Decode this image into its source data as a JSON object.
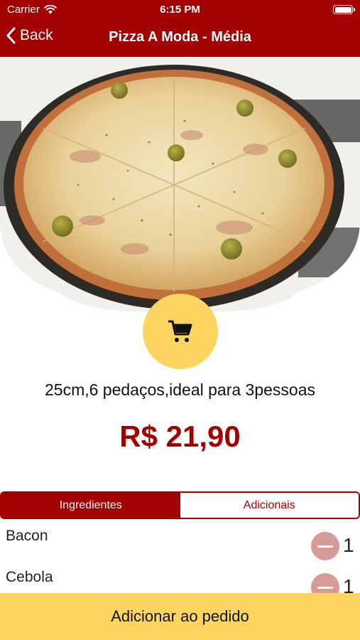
{
  "status_bar": {
    "carrier": "Carrier",
    "time": "6:15 PM"
  },
  "nav": {
    "back_label": "Back",
    "title": "Pizza A Moda - Média"
  },
  "product": {
    "description": "25cm,6 pedaços,ideal para 3pessoas",
    "price": "R$ 21,90"
  },
  "tabs": [
    {
      "label": "Ingredientes",
      "active": true
    },
    {
      "label": "Adicionais",
      "active": false
    }
  ],
  "ingredients": [
    {
      "name": "Bacon",
      "quantity": "1"
    },
    {
      "name": "Cebola",
      "quantity": "1"
    }
  ],
  "footer": {
    "add_button_label": "Adicionar ao pedido"
  },
  "colors": {
    "brand_red": "#a30000",
    "accent_yellow": "#fbd55f",
    "minus_button": "#d69b96"
  },
  "icons": {
    "back": "chevron-left-icon",
    "cart": "shopping-cart-icon",
    "wifi": "wifi-icon",
    "battery": "battery-icon",
    "minus": "minus-icon"
  }
}
